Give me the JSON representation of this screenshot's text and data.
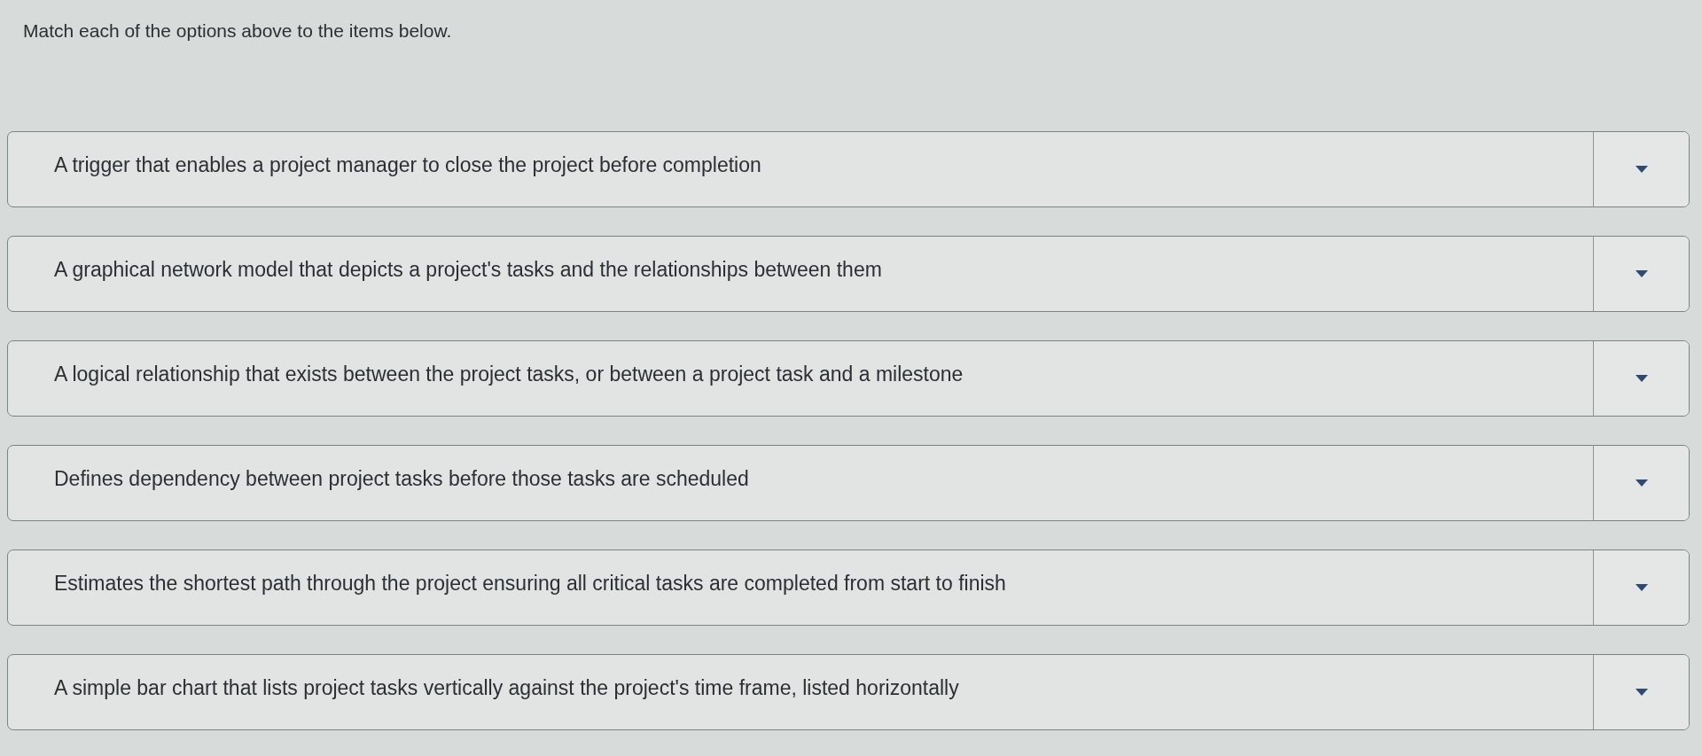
{
  "instruction": "Match each of the options above to the items below.",
  "items": [
    {
      "text": "A trigger that enables a project manager to close the project before completion"
    },
    {
      "text": "A graphical network model that depicts a project's tasks and the relationships between them"
    },
    {
      "text": "A logical relationship that exists between the project tasks, or between a project task and a milestone"
    },
    {
      "text": "Defines dependency between project tasks before those tasks are scheduled"
    },
    {
      "text": "Estimates the shortest path through the project ensuring all critical tasks are completed from start to finish"
    },
    {
      "text": "A simple bar chart that lists project tasks vertically against the project's time frame, listed horizontally"
    }
  ]
}
